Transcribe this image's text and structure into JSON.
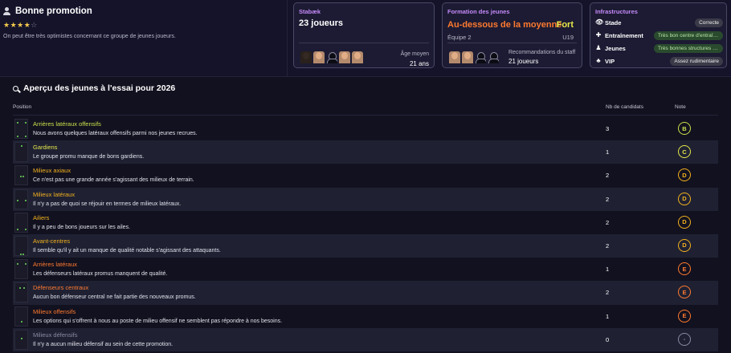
{
  "promotion": {
    "title": "Bonne promotion",
    "stars_filled": "★★★★",
    "stars_empty": "☆",
    "rating_stars": 4,
    "rating_max": 5,
    "description": "On peut être très optimistes concernant ce groupe de jeunes joueurs."
  },
  "club_card": {
    "title": "Stabæk",
    "players": "23 joueurs",
    "avg_age_label": "Âge moyen",
    "avg_age_value": "21 ans"
  },
  "training_card": {
    "title": "Formation des jeunes",
    "rating": "Au-dessous de la moyenne",
    "strength": "Fort",
    "team": "Équipe 2",
    "age_group": "U19",
    "staff_label": "Recommandations du staff",
    "staff_value": "21 joueurs"
  },
  "infra_card": {
    "title": "Infrastructures",
    "items": [
      {
        "icon": "eye-icon",
        "glyph": "👁",
        "label": "Stade",
        "value": "Correcte",
        "tone": "gray"
      },
      {
        "icon": "dumbbell-icon",
        "glyph": "✚",
        "label": "Entraînement",
        "value": "Très bon centre d'entraînement",
        "tone": "green"
      },
      {
        "icon": "youth-icon",
        "glyph": "♟",
        "label": "Jeunes",
        "value": "Très bonnes structures des jeunes",
        "tone": "green"
      },
      {
        "icon": "vip-icon",
        "glyph": "♣",
        "label": "VIP",
        "value": "Assez rudimentaire",
        "tone": "gray"
      }
    ]
  },
  "section": {
    "title": "Aperçu des jeunes à l'essai pour 2026",
    "col_position": "Position",
    "col_count": "Nb de candidats",
    "col_note": "Note"
  },
  "rows": [
    {
      "name": "Arrières latéraux offensifs",
      "desc": "Nous avons quelques latéraux offensifs parmi nos jeunes recrues.",
      "count": "3",
      "grade": "B",
      "color": "#c8e04a",
      "dots": [
        [
          2,
          3
        ],
        [
          2,
          20
        ],
        [
          12,
          3
        ],
        [
          12,
          20
        ]
      ]
    },
    {
      "name": "Gardiens",
      "desc": "Le groupe promu manque de bons gardiens.",
      "count": "1",
      "grade": "C",
      "color": "#e6e84a",
      "dots": [
        [
          7,
          3
        ]
      ]
    },
    {
      "name": "Milieux axiaux",
      "desc": "Ce n'est pas une grande année s'agissant des milieux de terrain.",
      "count": "2",
      "grade": "D",
      "color": "#f2b11e",
      "dots": [
        [
          6,
          12
        ],
        [
          9,
          12
        ]
      ]
    },
    {
      "name": "Milieux latéraux",
      "desc": "Il n'y a pas de quoi se réjouir en termes de milieux latéraux.",
      "count": "2",
      "grade": "D",
      "color": "#f2b11e",
      "dots": [
        [
          2,
          12
        ],
        [
          12,
          12
        ]
      ]
    },
    {
      "name": "Ailiers",
      "desc": "Il y a peu de bons joueurs sur les ailes.",
      "count": "2",
      "grade": "D",
      "color": "#f2b11e",
      "dots": [
        [
          2,
          19
        ],
        [
          12,
          19
        ]
      ]
    },
    {
      "name": "Avant-centres",
      "desc": "Il semble qu'il y ait un manque de qualité notable s'agissant des attaquants.",
      "count": "2",
      "grade": "D",
      "color": "#f2b11e",
      "dots": [
        [
          6,
          21
        ],
        [
          9,
          21
        ]
      ]
    },
    {
      "name": "Arrières latéraux",
      "desc": "Les défenseurs latéraux promus manquent de qualité.",
      "count": "1",
      "grade": "E",
      "color": "#ff7a2f",
      "dots": [
        [
          2,
          4
        ],
        [
          12,
          4
        ]
      ]
    },
    {
      "name": "Défenseurs centraux",
      "desc": "Aucun bon défenseur central ne fait partie des nouveaux promus.",
      "count": "2",
      "grade": "E",
      "color": "#ff7a2f",
      "dots": [
        [
          5,
          5
        ],
        [
          10,
          5
        ]
      ]
    },
    {
      "name": "Milieux offensifs",
      "desc": "Les options qui s'offrent à nous au poste de milieu offensif ne semblent pas répondre à nos besoins.",
      "count": "1",
      "grade": "E",
      "color": "#ff7a2f",
      "dots": [
        [
          7,
          17
        ]
      ]
    },
    {
      "name": "Milieux défensifs",
      "desc": "Il n'y a aucun milieu défensif au sein de cette promotion.",
      "count": "0",
      "grade": "-",
      "color": "#8a8aa0",
      "dots": [
        [
          7,
          9
        ]
      ]
    }
  ]
}
